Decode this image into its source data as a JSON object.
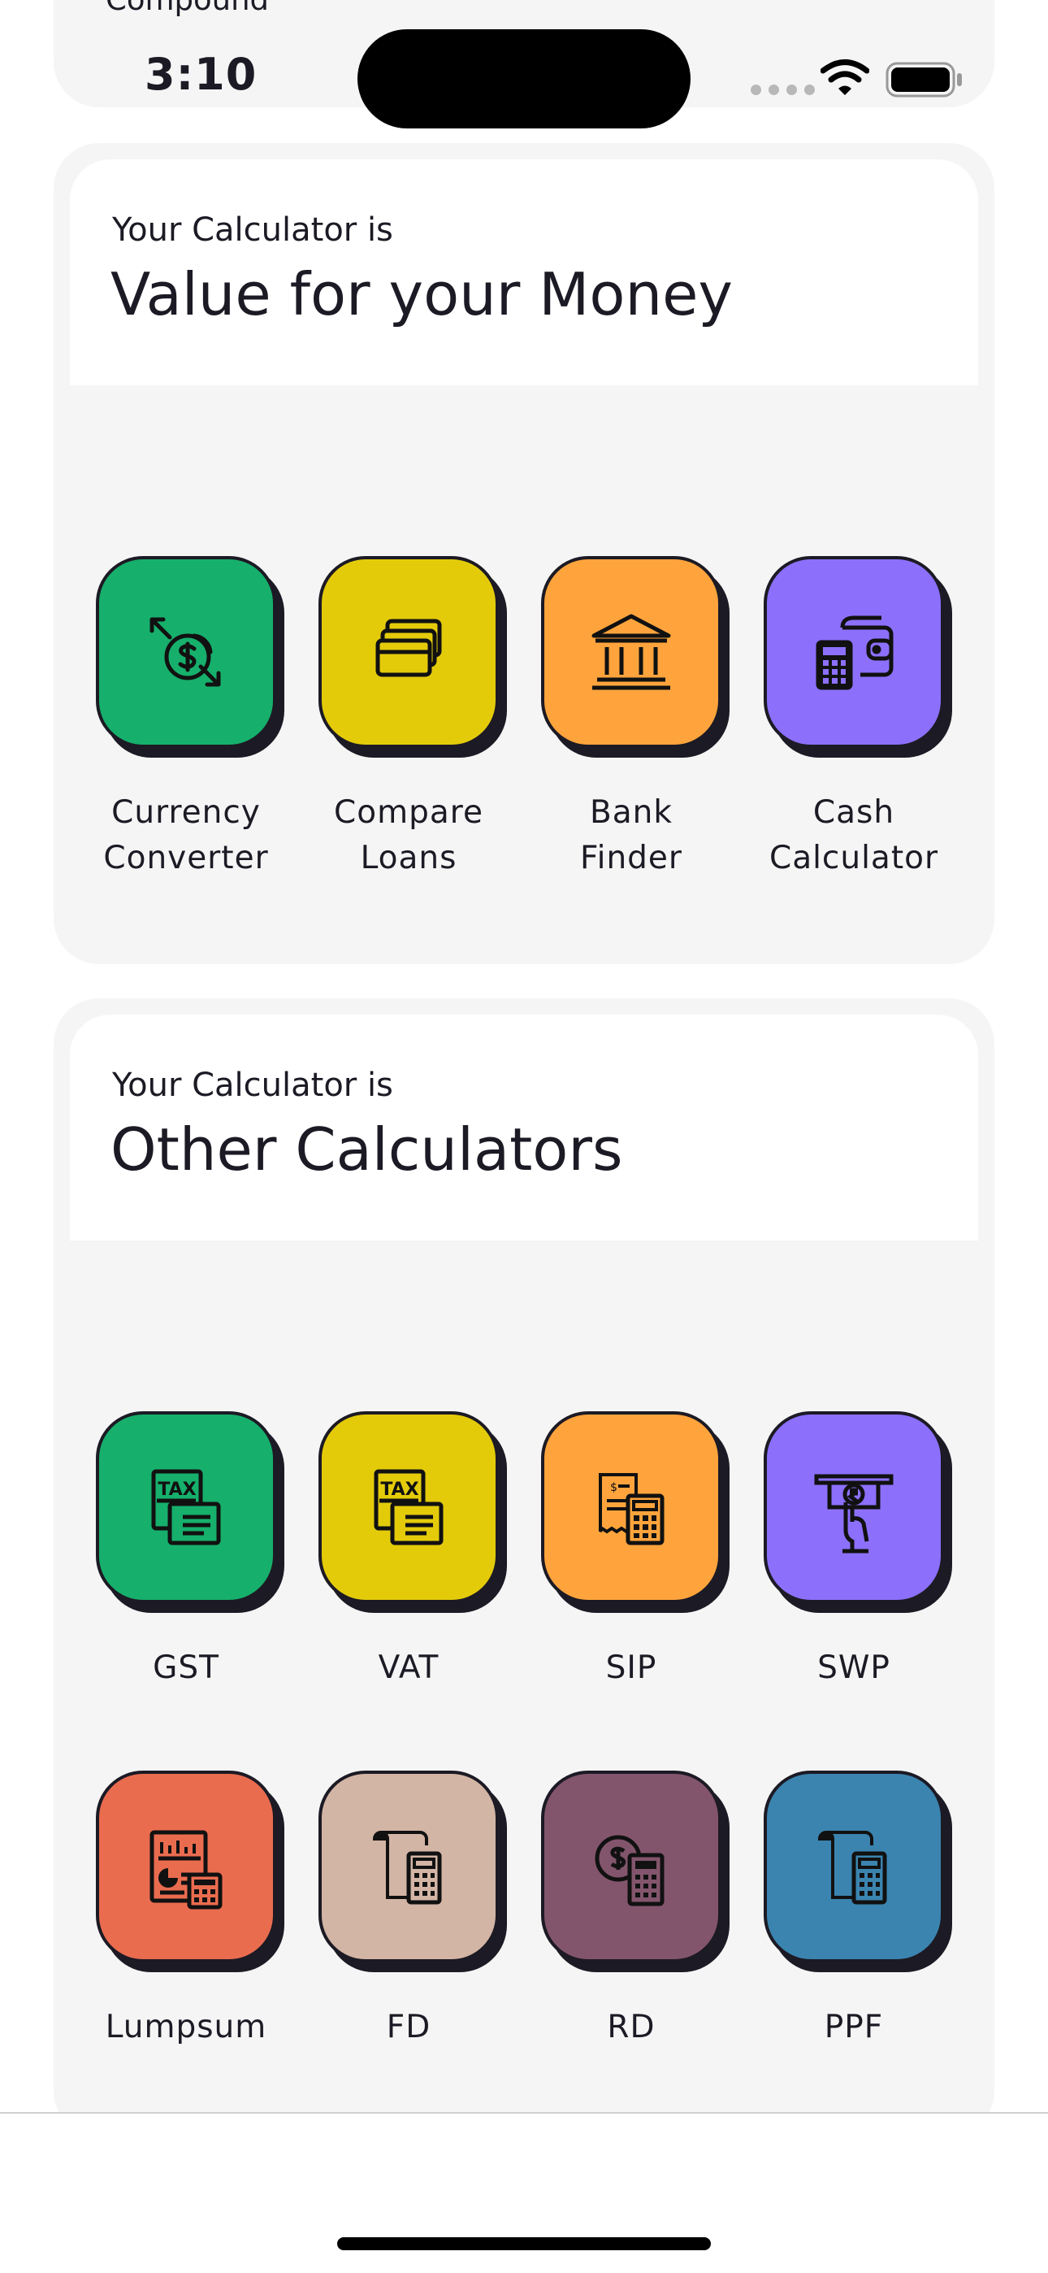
{
  "status_bar": {
    "time": "3:10"
  },
  "previous_card": {
    "label": "Compound"
  },
  "sections": [
    {
      "subtitle": "Your Calculator is",
      "title": "Value for your Money",
      "tiles": [
        {
          "label": "Currency\nConverter",
          "icon": "currency-exchange-icon",
          "color": "#16b06c"
        },
        {
          "label": "Compare\nLoans",
          "icon": "cards-icon",
          "color": "#e4cb0a"
        },
        {
          "label": "Bank\nFinder",
          "icon": "bank-icon",
          "color": "#ffa43c"
        },
        {
          "label": "Cash\nCalculator",
          "icon": "wallet-calculator-icon",
          "color": "#8c70fb"
        }
      ]
    },
    {
      "subtitle": "Your Calculator is",
      "title": "Other Calculators",
      "tiles": [
        {
          "label": "GST",
          "icon": "tax-document-icon",
          "color": "#16b06c"
        },
        {
          "label": "VAT",
          "icon": "tax-document-icon",
          "color": "#e4cb0a"
        },
        {
          "label": "SIP",
          "icon": "receipt-calculator-icon",
          "color": "#ffa43c"
        },
        {
          "label": "SWP",
          "icon": "atm-withdraw-icon",
          "color": "#8c70fb"
        },
        {
          "label": "Lumpsum",
          "icon": "report-calculator-icon",
          "color": "#ea6c4f"
        },
        {
          "label": "FD",
          "icon": "scroll-calculator-icon",
          "color": "#d3b5a5"
        },
        {
          "label": "RD",
          "icon": "coin-calculator-icon",
          "color": "#83556c"
        },
        {
          "label": "PPF",
          "icon": "scroll-calculator-icon",
          "color": "#3b84b0"
        }
      ]
    }
  ]
}
